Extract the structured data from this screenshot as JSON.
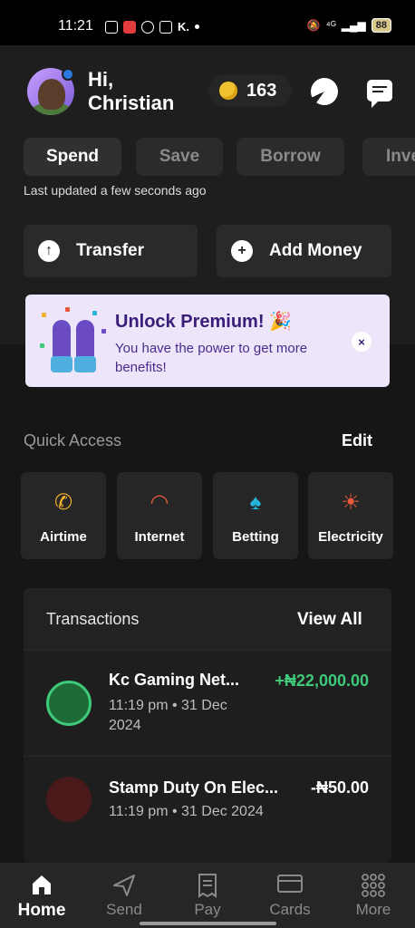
{
  "status_bar": {
    "time": "11:21",
    "left_icons": [
      "b-icon",
      "video-icon",
      "record-icon",
      "bank-icon",
      "k-icon"
    ],
    "k_text": "K.",
    "network": "⁴ᴳ",
    "battery": "88"
  },
  "header": {
    "greeting": "Hi,",
    "name": "Christian",
    "coin_count": "163",
    "icons": [
      "pie-chart-icon",
      "chat-icon"
    ]
  },
  "tabs": [
    "Spend",
    "Save",
    "Borrow",
    "Inve"
  ],
  "active_tab": "Spend",
  "updated_text": "Last updated a few seconds ago",
  "actions": {
    "transfer": "Transfer",
    "add_money": "Add Money"
  },
  "promo": {
    "title": "Unlock Premium! 🎉",
    "description": "You have the power to get more benefits!",
    "close": "×"
  },
  "quick_access": {
    "label": "Quick Access",
    "edit": "Edit",
    "items": [
      {
        "label": "Airtime",
        "icon": "phone-icon",
        "glyph": "📞",
        "color": "#f2b12e"
      },
      {
        "label": "Internet",
        "icon": "wifi-icon",
        "glyph": "📶",
        "color": "#e8573c"
      },
      {
        "label": "Betting",
        "icon": "spade-icon",
        "glyph": "♠",
        "color": "#25b5d9"
      },
      {
        "label": "Electricity",
        "icon": "bulb-icon",
        "glyph": "💡",
        "color": "#e8573c"
      }
    ]
  },
  "transactions": {
    "title": "Transactions",
    "view_all": "View All",
    "items": [
      {
        "name": "Kc Gaming Net...",
        "date": "11:19 pm • 31 Dec 2024",
        "amount": "+₦22,000.00",
        "amount_color": "#3fc97a",
        "logo_color": "#1f6b38"
      },
      {
        "name": "Stamp Duty On Elec...",
        "date": "11:19 pm • 31 Dec 2024",
        "amount": "-₦50.00",
        "amount_color": "#ffffff",
        "logo_color": "#4a1a1a"
      }
    ]
  },
  "bottom_nav": [
    {
      "label": "Home",
      "icon": "home-icon"
    },
    {
      "label": "Send",
      "icon": "send-icon"
    },
    {
      "label": "Pay",
      "icon": "receipt-icon"
    },
    {
      "label": "Cards",
      "icon": "card-icon"
    },
    {
      "label": "More",
      "icon": "grid-icon"
    }
  ]
}
